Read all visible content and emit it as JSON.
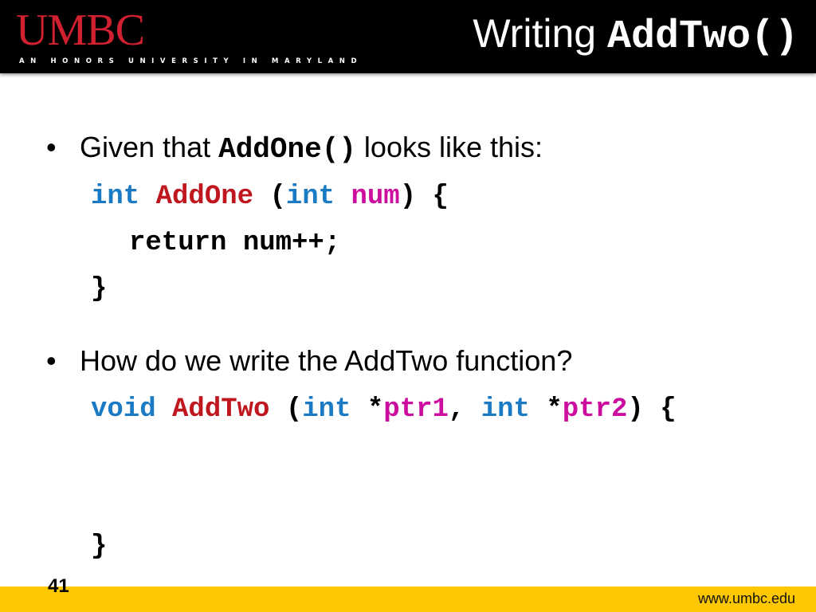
{
  "header": {
    "logo": "UMBC",
    "tagline": "AN HONORS UNIVERSITY IN MARYLAND",
    "title_plain": "Writing ",
    "title_code": "AddTwo()"
  },
  "bullets": [
    {
      "pre": "Given that ",
      "code": "AddOne()",
      "post": " looks like this:"
    },
    {
      "text": "How do we write the AddTwo function?"
    }
  ],
  "code_block_1": {
    "line1": {
      "kw1": "int",
      "fn": "AddOne",
      "p1": " (",
      "kw2": "int",
      "var": "num",
      "p2": ") {"
    },
    "line2": "return num++;",
    "line3": "}"
  },
  "code_block_2": {
    "line1": {
      "kw1": "void",
      "fn": "AddTwo",
      "p1": " (",
      "kw2": "int",
      "star1": " *",
      "var1": "ptr1",
      "comma": ", ",
      "kw3": "int",
      "star2": " *",
      "var2": "ptr2",
      "p2": ") {"
    },
    "line_close": "}"
  },
  "colors": {
    "keyword": "#1a7bc4",
    "function": "#c0171f",
    "variable": "#cc0e9e",
    "brand_red": "#d1202f",
    "footer_gold": "#fdc800"
  },
  "footer": {
    "page_number": "41",
    "url": "www.umbc.edu"
  }
}
